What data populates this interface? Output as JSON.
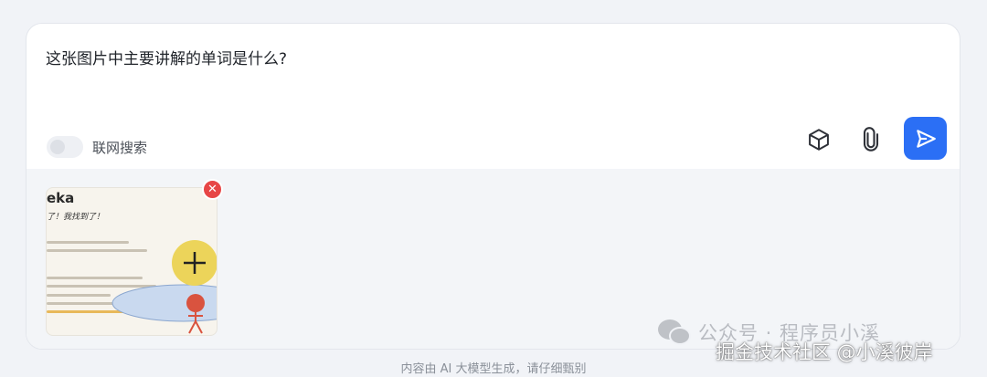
{
  "question": "这张图片中主要讲解的单词是什么?",
  "toggle": {
    "label": "联网搜索",
    "enabled": false
  },
  "toolbar": {
    "model_icon": "cube-icon",
    "attach_icon": "paperclip-icon",
    "send_icon": "send-icon",
    "send_color": "#2b6ff5"
  },
  "attachment": {
    "title": "eka",
    "subtitle": "了！我找到了！",
    "remove_icon": "close-icon",
    "remove_symbol": "✕"
  },
  "footer": "内容由 AI 大模型生成，请仔细甄别",
  "watermark": {
    "back": "公众号 · 程序员小溪",
    "front": "掘金技术社区 @小溪彼岸"
  }
}
